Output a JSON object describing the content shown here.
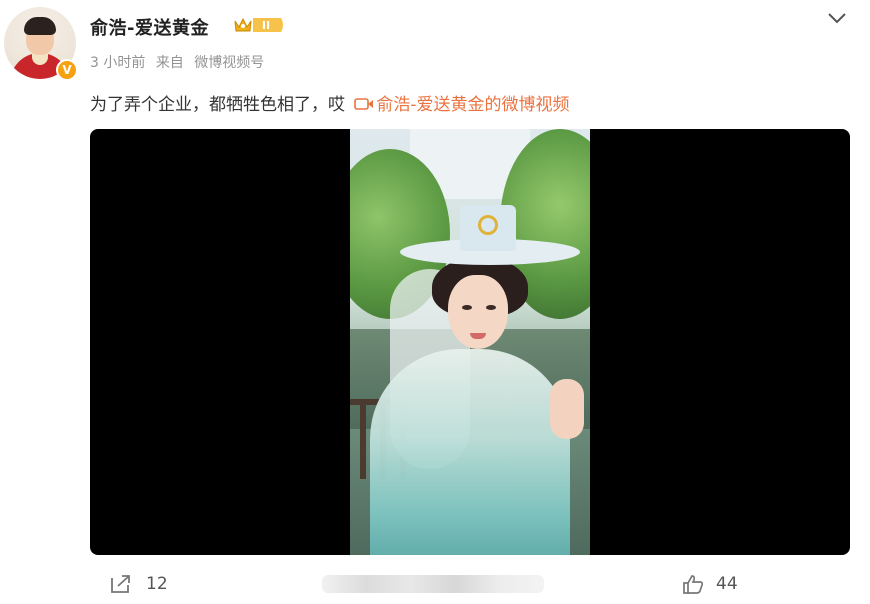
{
  "post": {
    "author": {
      "name": "俞浩-爱送黄金",
      "verified_mark": "V",
      "level_badge": "II"
    },
    "meta": {
      "time": "3 小时前",
      "from_prefix": "来自",
      "source": "微博视频号"
    },
    "text": {
      "body": "为了弄个企业，都牺牲色相了，哎",
      "video_link": "俞浩-爱送黄金的微博视频"
    },
    "icons": {
      "more": "chevron-down-icon",
      "video": "video-camera-icon",
      "share": "share-icon",
      "like": "thumbs-up-icon"
    }
  },
  "actions": {
    "share_count": "12",
    "like_count": "44"
  },
  "colors": {
    "link": "#eb7340",
    "meta": "#939393",
    "verified": "#f7a10f",
    "video_bg": "#000000"
  }
}
